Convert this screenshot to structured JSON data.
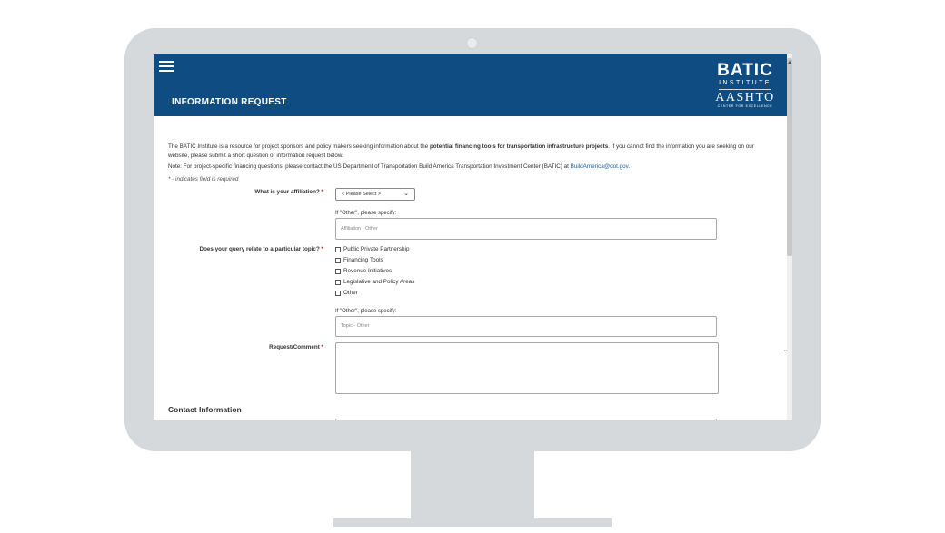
{
  "header": {
    "page_title": "INFORMATION REQUEST",
    "logo": {
      "batic": "BATIC",
      "institute": "INSTITUTE",
      "aashto": "AASHTO",
      "center": "CENTER FOR EXCELLENCE"
    }
  },
  "intro": {
    "before": "The BATIC Institute is a resource for project sponsors and policy makers seeking information about the ",
    "bold": "potential financing tools for transportation infrastructure projects",
    "after": ". If you cannot find the information you are seeking on our website, please submit a short question or information request below."
  },
  "note": {
    "text": "Note: For project-specific financing questions, please contact the US Department of Transportation Build America Transportation Investment Center (BATIC) at ",
    "link": "BuildAmerica@dot.gov",
    "end": "."
  },
  "required_note": "* - indicates field is required",
  "form": {
    "affiliation": {
      "label": "What is your affiliation?",
      "required_mark": "*",
      "selected": "< Please Select >",
      "other_label": "If \"Other\", please specify:",
      "other_placeholder": "Affiliation - Other"
    },
    "topic": {
      "label": "Does your query relate to a particular topic?",
      "required_mark": "*",
      "options": [
        "Public Private Partnership",
        "Financing Tools",
        "Revenue Initiatives",
        "Legislative and Policy Areas",
        "Other"
      ],
      "other_label": "If \"Other\", please specify:",
      "other_placeholder": "Topic - Other"
    },
    "request": {
      "label": "Request/Comment",
      "required_mark": "*"
    }
  },
  "contact_section_title": "Contact Information",
  "colors": {
    "header_blue": "#0f4c81",
    "required_red": "#c00000",
    "link_blue": "#1a5e9c"
  },
  "icons": {
    "menu": "hamburger-menu-icon",
    "select": "chevron-down-icon",
    "scroll_top": "chevron-up-icon"
  }
}
